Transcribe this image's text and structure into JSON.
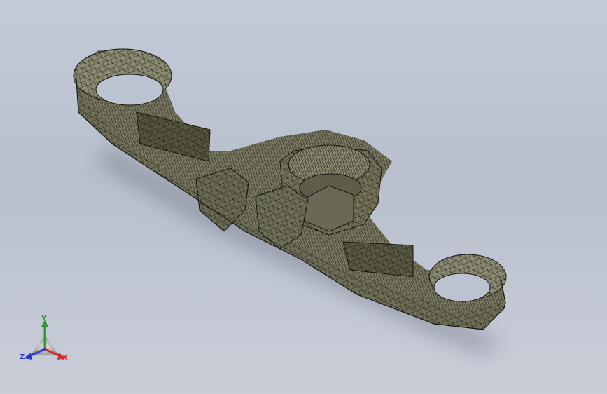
{
  "viewport": {
    "background_top": "#c4cbd8",
    "background_bottom": "#c9ced8",
    "model": {
      "mesh_fill": "#6d6c56",
      "mesh_fill_light": "#8a8970",
      "edge_color": "#15150f"
    },
    "triad": {
      "x_label": "X",
      "y_label": "Y",
      "z_label": "Z",
      "x_color": "#d02a2a",
      "y_color": "#2d9a2d",
      "z_color": "#2b39c8"
    }
  }
}
